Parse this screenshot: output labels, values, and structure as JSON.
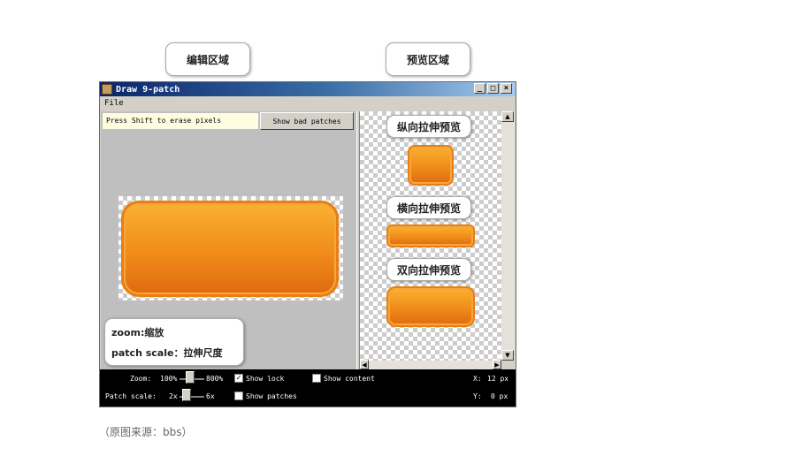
{
  "callouts": {
    "edit_area": "编辑区域",
    "preview_area": "预览区域",
    "vertical_preview": "纵向拉伸预览",
    "horizontal_preview": "横向拉伸预览",
    "both_preview": "双向拉伸预览",
    "zoom_note": "zoom:缩放",
    "patch_note": "patch scale：拉伸尺度"
  },
  "window": {
    "title": "Draw 9-patch",
    "minimize": "_",
    "maximize": "□",
    "close": "×",
    "menu": {
      "file": "File"
    }
  },
  "editor": {
    "hint": "Press Shift to erase pixels",
    "show_bad_patches": "Show bad patches"
  },
  "scroll": {
    "up": "▲",
    "down": "▼",
    "left": "◀",
    "right": "▶"
  },
  "bottombar": {
    "zoom_label": "Zoom:",
    "zoom_min": "100%",
    "zoom_max": "800%",
    "patch_scale_label": "Patch scale:",
    "patch_min": "2x",
    "patch_max": "6x",
    "show_lock": "Show lock",
    "show_lock_checked": true,
    "show_content": "Show content",
    "show_content_checked": false,
    "show_patches": "Show patches",
    "show_patches_checked": false,
    "x_label": "X:",
    "x_value": "12 px",
    "y_label": "Y:",
    "y_value": "0 px",
    "check_mark": "✓"
  },
  "caption": "（原图来源：bbs）",
  "colors": {
    "orange_top": "#f9b131",
    "orange_bottom": "#e06a10",
    "titlebar": "#0a246a",
    "hint_bg": "#fffde0"
  }
}
